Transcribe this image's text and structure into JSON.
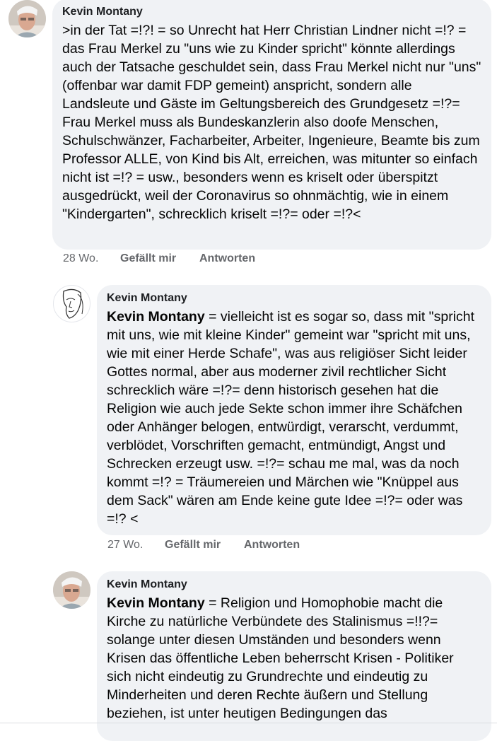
{
  "comments": [
    {
      "author": "Kevin Montany",
      "mention": "",
      "text": ">in der Tat =!?! = so Unrecht hat Herr Christian Lindner nicht =!? = das Frau Merkel zu \"uns wie zu Kinder spricht\" könnte allerdings auch der Tatsache geschuldet sein, dass Frau Merkel nicht nur \"uns\" (offenbar war damit FDP gemeint) anspricht, sondern alle Landsleute und Gäste im Geltungsbereich des Grundgesetz =!?= Frau Merkel muss als Bundeskanzlerin also doofe Menschen, Schulschwänzer, Facharbeiter, Arbeiter, Ingenieure, Beamte bis zum Professor ALLE, von Kind bis Alt, erreichen, was mitunter so einfach nicht ist =!? = usw., besonders wenn es kriselt oder überspitzt ausgedrückt, weil der Coronavirus so ohnmächtig, wie in einem \"Kindergarten\", schrecklich kriselt =!?= oder =!?<",
      "time": "28 Wo.",
      "like": "Gefällt mir",
      "reply": "Antworten",
      "avatar_icon": "profile-photo"
    },
    {
      "author": "Kevin Montany",
      "mention": "Kevin Montany",
      "text": " = vielleicht ist es sogar so, dass mit \"spricht mit uns, wie mit kleine Kinder\" gemeint war \"spricht mit uns, wie mit einer Herde Schafe\", was aus religiöser Sicht leider Gottes normal, aber aus moderner zivil rechtlicher Sicht schrecklich wäre =!?= denn historisch gesehen hat die Religion wie  auch jede Sekte schon immer ihre Schäfchen oder Anhänger belogen, entwürdigt, verarscht, verdummt, verblödet, Vorschriften gemacht, entmündigt, Angst und Schrecken erzeugt usw. =!?= schau me mal, was da noch kommt =!? = Träumereien und Märchen wie \"Knüppel aus dem Sack\" wären am Ende keine gute Idee =!?= oder was =!? <",
      "time": "27 Wo.",
      "like": "Gefällt mir",
      "reply": "Antworten",
      "avatar_icon": "sketch-face"
    },
    {
      "author": "Kevin Montany",
      "mention": "Kevin Montany",
      "text": " = Religion und Homophobie macht die Kirche zu natürliche Verbündete des Stalinismus =!!?= solange unter diesen Umständen und besonders wenn Krisen das öffentliche Leben beherrscht Krisen - Politiker sich  nicht eindeutig zu Grundrechte und eindeutig zu Minderheiten und deren Rechte äußern und Stellung beziehen, ist unter heutigen Bedingungen das",
      "avatar_icon": "profile-photo"
    }
  ]
}
